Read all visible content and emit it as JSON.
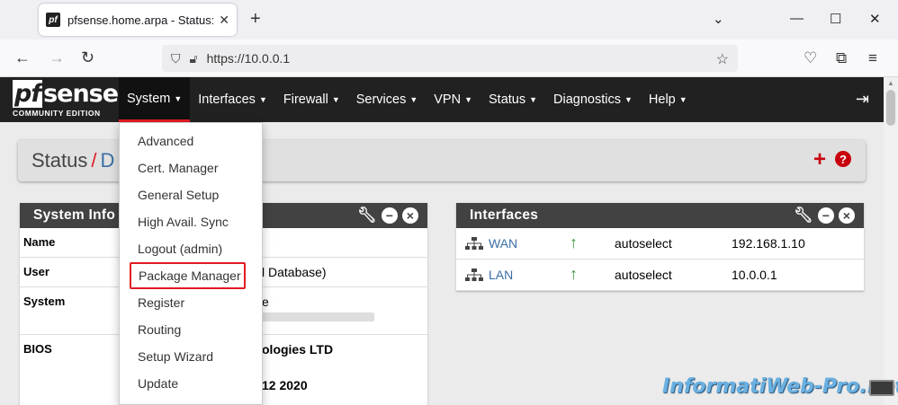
{
  "browser": {
    "tab_title": "pfsense.home.arpa - Status: Das",
    "favicon_text": "pf",
    "new_tab": "+",
    "url": "https://10.0.0.1"
  },
  "pfsense": {
    "logo_main": "sense",
    "logo_pf": "pf",
    "logo_sub": "COMMUNITY EDITION",
    "menu": [
      {
        "label": "System"
      },
      {
        "label": "Interfaces"
      },
      {
        "label": "Firewall"
      },
      {
        "label": "Services"
      },
      {
        "label": "VPN"
      },
      {
        "label": "Status"
      },
      {
        "label": "Diagnostics"
      },
      {
        "label": "Help"
      }
    ],
    "system_menu": [
      "Advanced",
      "Cert. Manager",
      "General Setup",
      "High Avail. Sync",
      "Logout (admin)",
      "Package Manager",
      "Register",
      "Routing",
      "Setup Wizard",
      "Update"
    ]
  },
  "breadcrumb": {
    "section": "Status",
    "separator": "/",
    "current": "D"
  },
  "system_info": {
    "title": "System Info",
    "rows": [
      {
        "key": "Name",
        "value": ""
      },
      {
        "key": "User",
        "value": "l Database)"
      },
      {
        "key": "System",
        "value": "e"
      },
      {
        "key": "BIOS",
        "value": "ologies LTD",
        "value2": "12 2020"
      }
    ]
  },
  "interfaces": {
    "title": "Interfaces",
    "rows": [
      {
        "name": "WAN",
        "media": "autoselect",
        "ip": "192.168.1.10"
      },
      {
        "name": "LAN",
        "media": "autoselect",
        "ip": "10.0.0.1"
      }
    ]
  },
  "watermark": "InformatiWeb-Pro.net",
  "colors": {
    "accent_red": "#e01b24",
    "link_blue": "#3a6ea5",
    "nav_dark": "#212121",
    "status_green": "#3c9a3c"
  }
}
